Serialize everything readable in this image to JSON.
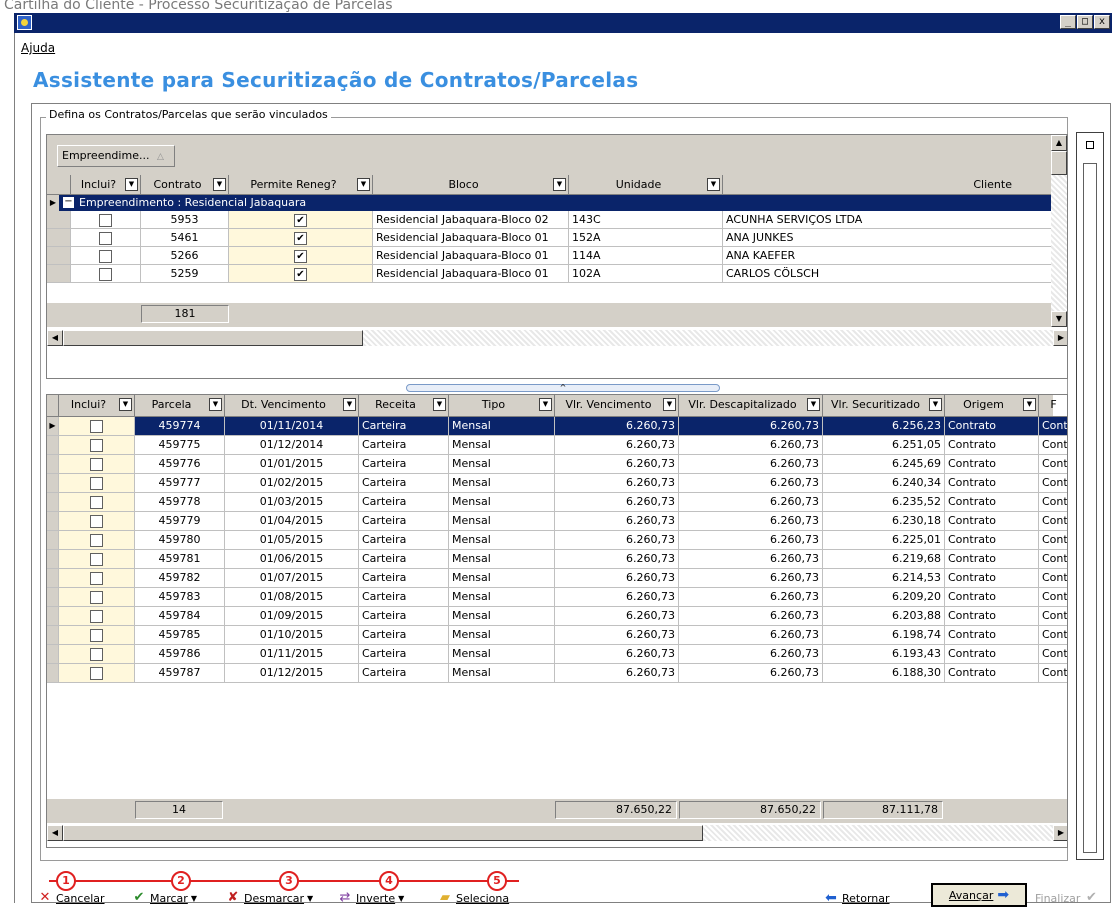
{
  "window": {
    "caption": "Cartilha do Cliente - Processo Securitização de Parcelas",
    "controls": [
      "_",
      "□",
      "x"
    ]
  },
  "menu": {
    "ajuda": "Ajuda"
  },
  "title": "Assistente para Securitização de Contratos/Parcelas",
  "group_legend": "Defina os Contratos/Parcelas que serão vinculados",
  "contracts_grid": {
    "group_button": "Empreendime...",
    "group_button_arrow": "△",
    "headers": [
      "Inclui?",
      "Contrato",
      "Permite Reneg?",
      "Bloco",
      "Unidade",
      "Cliente"
    ],
    "group_row": "Empreendimento : Residencial Jabaquara",
    "rows": [
      {
        "contrato": "5953",
        "reneg": true,
        "bloco": "Residencial Jabaquara-Bloco 02",
        "unidade": "143C",
        "cliente": "ACUNHA SERVIÇOS LTDA"
      },
      {
        "contrato": "5461",
        "reneg": true,
        "bloco": "Residencial Jabaquara-Bloco 01",
        "unidade": "152A",
        "cliente": "ANA JUNKES"
      },
      {
        "contrato": "5266",
        "reneg": true,
        "bloco": "Residencial Jabaquara-Bloco 01",
        "unidade": "114A",
        "cliente": "ANA KAEFER"
      },
      {
        "contrato": "5259",
        "reneg": true,
        "bloco": "Residencial Jabaquara-Bloco 01",
        "unidade": "102A",
        "cliente": "CARLOS CÖLSCH"
      }
    ],
    "footer_count": "181"
  },
  "splitter_arrow": "^",
  "parcels_grid": {
    "headers": [
      "Inclui?",
      "Parcela",
      "Dt. Vencimento",
      "Receita",
      "Tipo",
      "Vlr. Vencimento",
      "Vlr. Descapitalizado",
      "Vlr. Securitizado",
      "Origem",
      "F"
    ],
    "rows": [
      {
        "parcela": "459774",
        "dt": "01/11/2014",
        "receita": "Carteira",
        "tipo": "Mensal",
        "venc": "6.260,73",
        "desc": "6.260,73",
        "sec": "6.256,23",
        "origem": "Contrato",
        "f": "Contra"
      },
      {
        "parcela": "459775",
        "dt": "01/12/2014",
        "receita": "Carteira",
        "tipo": "Mensal",
        "venc": "6.260,73",
        "desc": "6.260,73",
        "sec": "6.251,05",
        "origem": "Contrato",
        "f": "Contra"
      },
      {
        "parcela": "459776",
        "dt": "01/01/2015",
        "receita": "Carteira",
        "tipo": "Mensal",
        "venc": "6.260,73",
        "desc": "6.260,73",
        "sec": "6.245,69",
        "origem": "Contrato",
        "f": "Contra"
      },
      {
        "parcela": "459777",
        "dt": "01/02/2015",
        "receita": "Carteira",
        "tipo": "Mensal",
        "venc": "6.260,73",
        "desc": "6.260,73",
        "sec": "6.240,34",
        "origem": "Contrato",
        "f": "Contra"
      },
      {
        "parcela": "459778",
        "dt": "01/03/2015",
        "receita": "Carteira",
        "tipo": "Mensal",
        "venc": "6.260,73",
        "desc": "6.260,73",
        "sec": "6.235,52",
        "origem": "Contrato",
        "f": "Contra"
      },
      {
        "parcela": "459779",
        "dt": "01/04/2015",
        "receita": "Carteira",
        "tipo": "Mensal",
        "venc": "6.260,73",
        "desc": "6.260,73",
        "sec": "6.230,18",
        "origem": "Contrato",
        "f": "Contra"
      },
      {
        "parcela": "459780",
        "dt": "01/05/2015",
        "receita": "Carteira",
        "tipo": "Mensal",
        "venc": "6.260,73",
        "desc": "6.260,73",
        "sec": "6.225,01",
        "origem": "Contrato",
        "f": "Contra"
      },
      {
        "parcela": "459781",
        "dt": "01/06/2015",
        "receita": "Carteira",
        "tipo": "Mensal",
        "venc": "6.260,73",
        "desc": "6.260,73",
        "sec": "6.219,68",
        "origem": "Contrato",
        "f": "Contra"
      },
      {
        "parcela": "459782",
        "dt": "01/07/2015",
        "receita": "Carteira",
        "tipo": "Mensal",
        "venc": "6.260,73",
        "desc": "6.260,73",
        "sec": "6.214,53",
        "origem": "Contrato",
        "f": "Contra"
      },
      {
        "parcela": "459783",
        "dt": "01/08/2015",
        "receita": "Carteira",
        "tipo": "Mensal",
        "venc": "6.260,73",
        "desc": "6.260,73",
        "sec": "6.209,20",
        "origem": "Contrato",
        "f": "Contra"
      },
      {
        "parcela": "459784",
        "dt": "01/09/2015",
        "receita": "Carteira",
        "tipo": "Mensal",
        "venc": "6.260,73",
        "desc": "6.260,73",
        "sec": "6.203,88",
        "origem": "Contrato",
        "f": "Contra"
      },
      {
        "parcela": "459785",
        "dt": "01/10/2015",
        "receita": "Carteira",
        "tipo": "Mensal",
        "venc": "6.260,73",
        "desc": "6.260,73",
        "sec": "6.198,74",
        "origem": "Contrato",
        "f": "Contra"
      },
      {
        "parcela": "459786",
        "dt": "01/11/2015",
        "receita": "Carteira",
        "tipo": "Mensal",
        "venc": "6.260,73",
        "desc": "6.260,73",
        "sec": "6.193,43",
        "origem": "Contrato",
        "f": "Contra"
      },
      {
        "parcela": "459787",
        "dt": "01/12/2015",
        "receita": "Carteira",
        "tipo": "Mensal",
        "venc": "6.260,73",
        "desc": "6.260,73",
        "sec": "6.188,30",
        "origem": "Contrato",
        "f": "Contra"
      }
    ],
    "footer": {
      "count": "14",
      "venc_total": "87.650,22",
      "desc_total": "87.650,22",
      "sec_total": "87.111,78"
    }
  },
  "toolbar": {
    "markers": [
      "1",
      "2",
      "3",
      "4",
      "5"
    ],
    "cancelar": "Cancelar",
    "marcar": "Marcar",
    "desmarcar": "Desmarcar",
    "inverte": "Inverte",
    "seleciona": "Seleciona",
    "retornar": "Retornar",
    "avancar": "Avançar",
    "finalizar": "Finalizar"
  },
  "icons": {
    "cancel": "cancel-x-icon",
    "mark": "mark-check-icon",
    "unmark": "unmark-icon",
    "invert": "invert-icon",
    "select": "folder-icon",
    "back": "arrow-left-icon",
    "next": "arrow-right-icon",
    "finish": "finish-check-icon"
  },
  "colors": {
    "title_blue": "#3a8fe0",
    "selection": "#0a246a",
    "marker_red": "#e02020",
    "reneg_bg": "#fff8dc"
  }
}
